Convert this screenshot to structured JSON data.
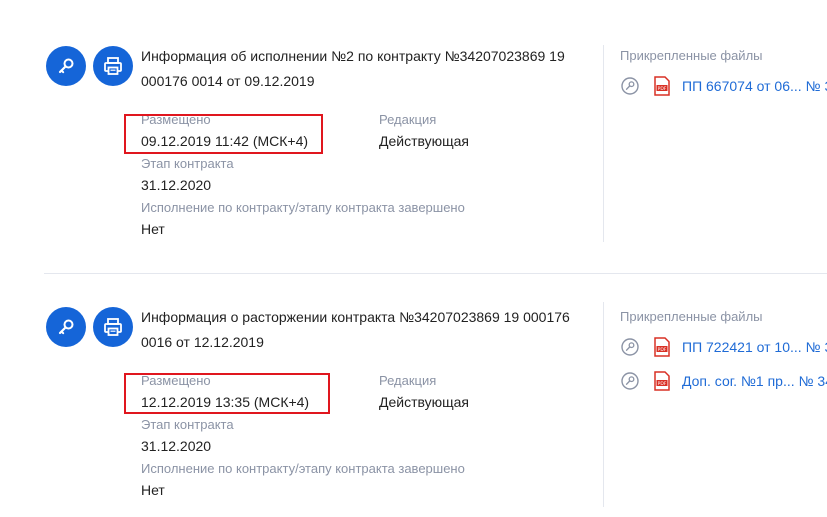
{
  "cards": [
    {
      "title": "Информация об исполнении №2 по контракту №34207023869 19 000176 0014 от 09.12.2019",
      "placed_label": "Размещено",
      "placed_value": "09.12.2019 11:42 (МСК+4)",
      "edition_label": "Редакция",
      "edition_value": "Действующая",
      "stage_label": "Этап контракта",
      "stage_value": "31.12.2020",
      "completed_label": "Исполнение по контракту/этапу контракта завершено",
      "completed_value": "Нет",
      "files_label": "Прикрепленные файлы",
      "files": [
        "ПП 667074 от 06... № 3"
      ]
    },
    {
      "title": "Информация о расторжении контракта №34207023869 19 000176 0016 от 12.12.2019",
      "placed_label": "Размещено",
      "placed_value": "12.12.2019 13:35 (МСК+4)",
      "edition_label": "Редакция",
      "edition_value": "Действующая",
      "stage_label": "Этап контракта",
      "stage_value": "31.12.2020",
      "completed_label": "Исполнение по контракту/этапу контракта завершено",
      "completed_value": "Нет",
      "files_label": "Прикрепленные файлы",
      "files": [
        "ПП 722421 от 10... № 3",
        "Доп. сог. №1 пр... № 34"
      ]
    }
  ],
  "icons": {
    "primary_button": "key-icon",
    "secondary_button": "printer-icon",
    "signature": "signature-key-icon",
    "file_type": "pdf-file-icon"
  },
  "colors": {
    "accent": "#1565d8",
    "link": "#1f6bd6",
    "highlight": "#e0161e",
    "muted": "#8b93a5"
  }
}
